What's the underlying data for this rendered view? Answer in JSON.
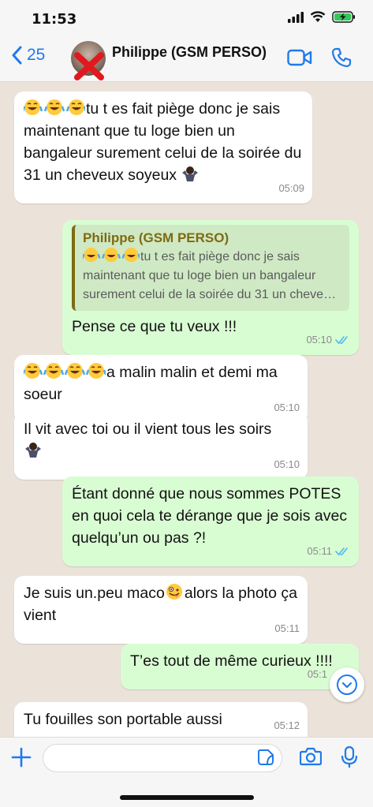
{
  "status": {
    "time": "11:53"
  },
  "header": {
    "back_count": "25",
    "contact_name": "Philippe (GSM PERSO)"
  },
  "messages": [
    {
      "dir": "in",
      "text": "tu t es fait piège donc je sais maintenant que tu loge bien un bangaleur surement celui de la soirée du 31 un cheveux soyeux",
      "time": "05:09"
    },
    {
      "dir": "out",
      "quote_name": "Philippe (GSM PERSO)",
      "quote_text": "tu t es fait piège donc je sais maintenant que tu loge bien un bangaleur surement celui de la soirée du 31 un cheve…",
      "text": "Pense ce que tu veux !!!",
      "time": "05:10"
    },
    {
      "dir": "in",
      "text": "a malin malin et demi ma soeur",
      "time": "05:10"
    },
    {
      "dir": "in",
      "text": "Il vit avec toi ou il vient tous les soirs",
      "time": "05:10"
    },
    {
      "dir": "out",
      "text": "Étant donné que nous sommes POTES en quoi cela te dérange que je sois avec quelqu’un ou pas ?!",
      "time": "05:11"
    },
    {
      "dir": "in",
      "text_before": "Je suis un.peu maco",
      "text_after": "alors la photo ça vient",
      "time": "05:11"
    },
    {
      "dir": "out",
      "text": "T’es tout de même curieux !!!!",
      "time": "05:1"
    },
    {
      "dir": "in",
      "text": "Tu fouilles son portable aussi",
      "time": "05:12"
    }
  ],
  "input": {
    "placeholder": "",
    "value": ""
  },
  "colors": {
    "accent": "#1f7aeb",
    "outgoing": "#d9fdd3",
    "incoming": "#ffffff",
    "tick_read": "#53bdeb"
  }
}
